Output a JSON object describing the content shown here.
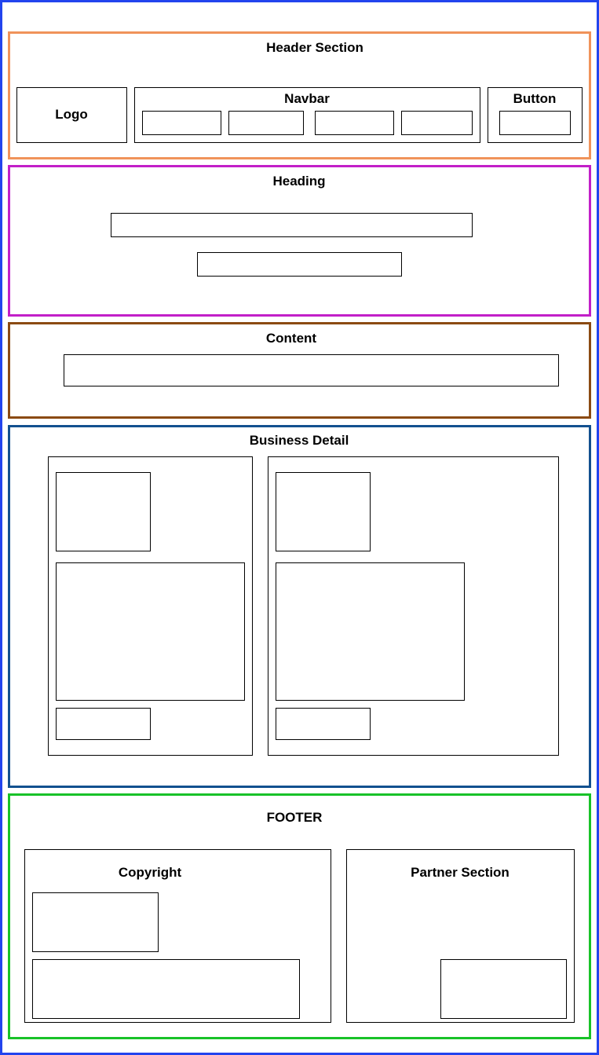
{
  "sections": {
    "header": {
      "title": "Header Section",
      "color": "#f0935a",
      "logo_label": "Logo",
      "navbar_label": "Navbar",
      "button_label": "Button"
    },
    "heading": {
      "title": "Heading",
      "color": "#c21fc8"
    },
    "content": {
      "title": "Content",
      "color": "#8b4a12"
    },
    "business": {
      "title": "Business Detail",
      "color": "#12508f"
    },
    "footer": {
      "title": "FOOTER",
      "color": "#18c228",
      "copyright_label": "Copyright",
      "partner_label": "Partner Section"
    }
  },
  "outer_border_color": "#2244ee"
}
